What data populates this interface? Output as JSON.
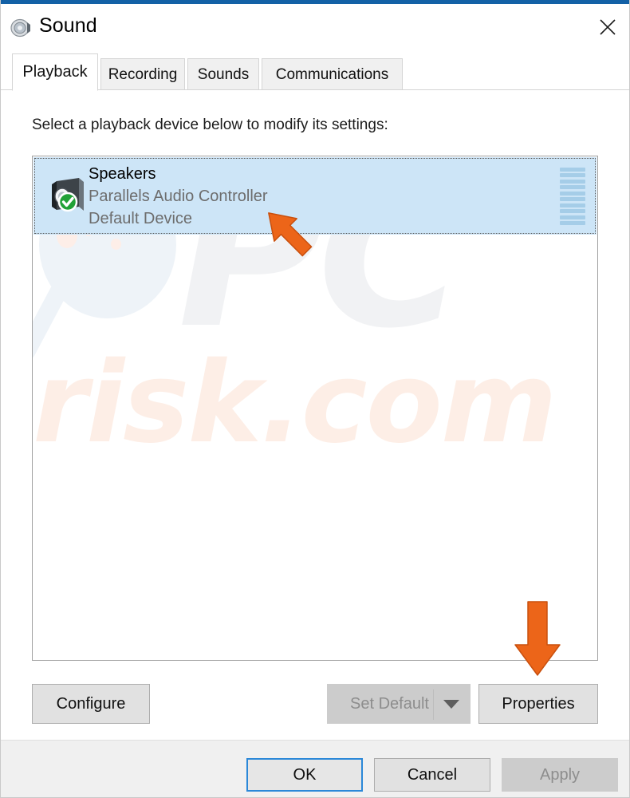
{
  "window": {
    "title": "Sound",
    "icon": "speaker-icon",
    "close_label": "×",
    "accent_color": "#1361a6"
  },
  "tabs": [
    {
      "label": "Playback",
      "active": true
    },
    {
      "label": "Recording",
      "active": false
    },
    {
      "label": "Sounds",
      "active": false
    },
    {
      "label": "Communications",
      "active": false
    }
  ],
  "playback": {
    "instruction": "Select a playback device below to modify its settings:",
    "devices": [
      {
        "name": "Speakers",
        "description": "Parallels Audio Controller",
        "status": "Default Device",
        "selected": true,
        "default_badge_icon": "green-check-icon",
        "device_icon": "speaker-device-icon",
        "volume_meter_bars": 10,
        "volume_meter_color": "#a5cde8"
      }
    ],
    "selection_color": "#cde5f7"
  },
  "watermark": {
    "text_primary": "PC",
    "text_secondary": "risk.com",
    "primary_color": "#f1f2f4",
    "secondary_color": "#fdeee6"
  },
  "device_buttons": {
    "configure": {
      "label": "Configure",
      "enabled": true
    },
    "set_default": {
      "label": "Set Default",
      "enabled": false,
      "has_dropdown": true
    },
    "properties": {
      "label": "Properties",
      "enabled": true
    }
  },
  "footer_buttons": {
    "ok": {
      "label": "OK",
      "enabled": true,
      "focused": true
    },
    "cancel": {
      "label": "Cancel",
      "enabled": true,
      "focused": false
    },
    "apply": {
      "label": "Apply",
      "enabled": false,
      "focused": false
    }
  },
  "annotations": {
    "color": "#ec6519",
    "cursor_arrow": "orange-cursor-arrow",
    "down_arrow": "orange-down-arrow"
  }
}
